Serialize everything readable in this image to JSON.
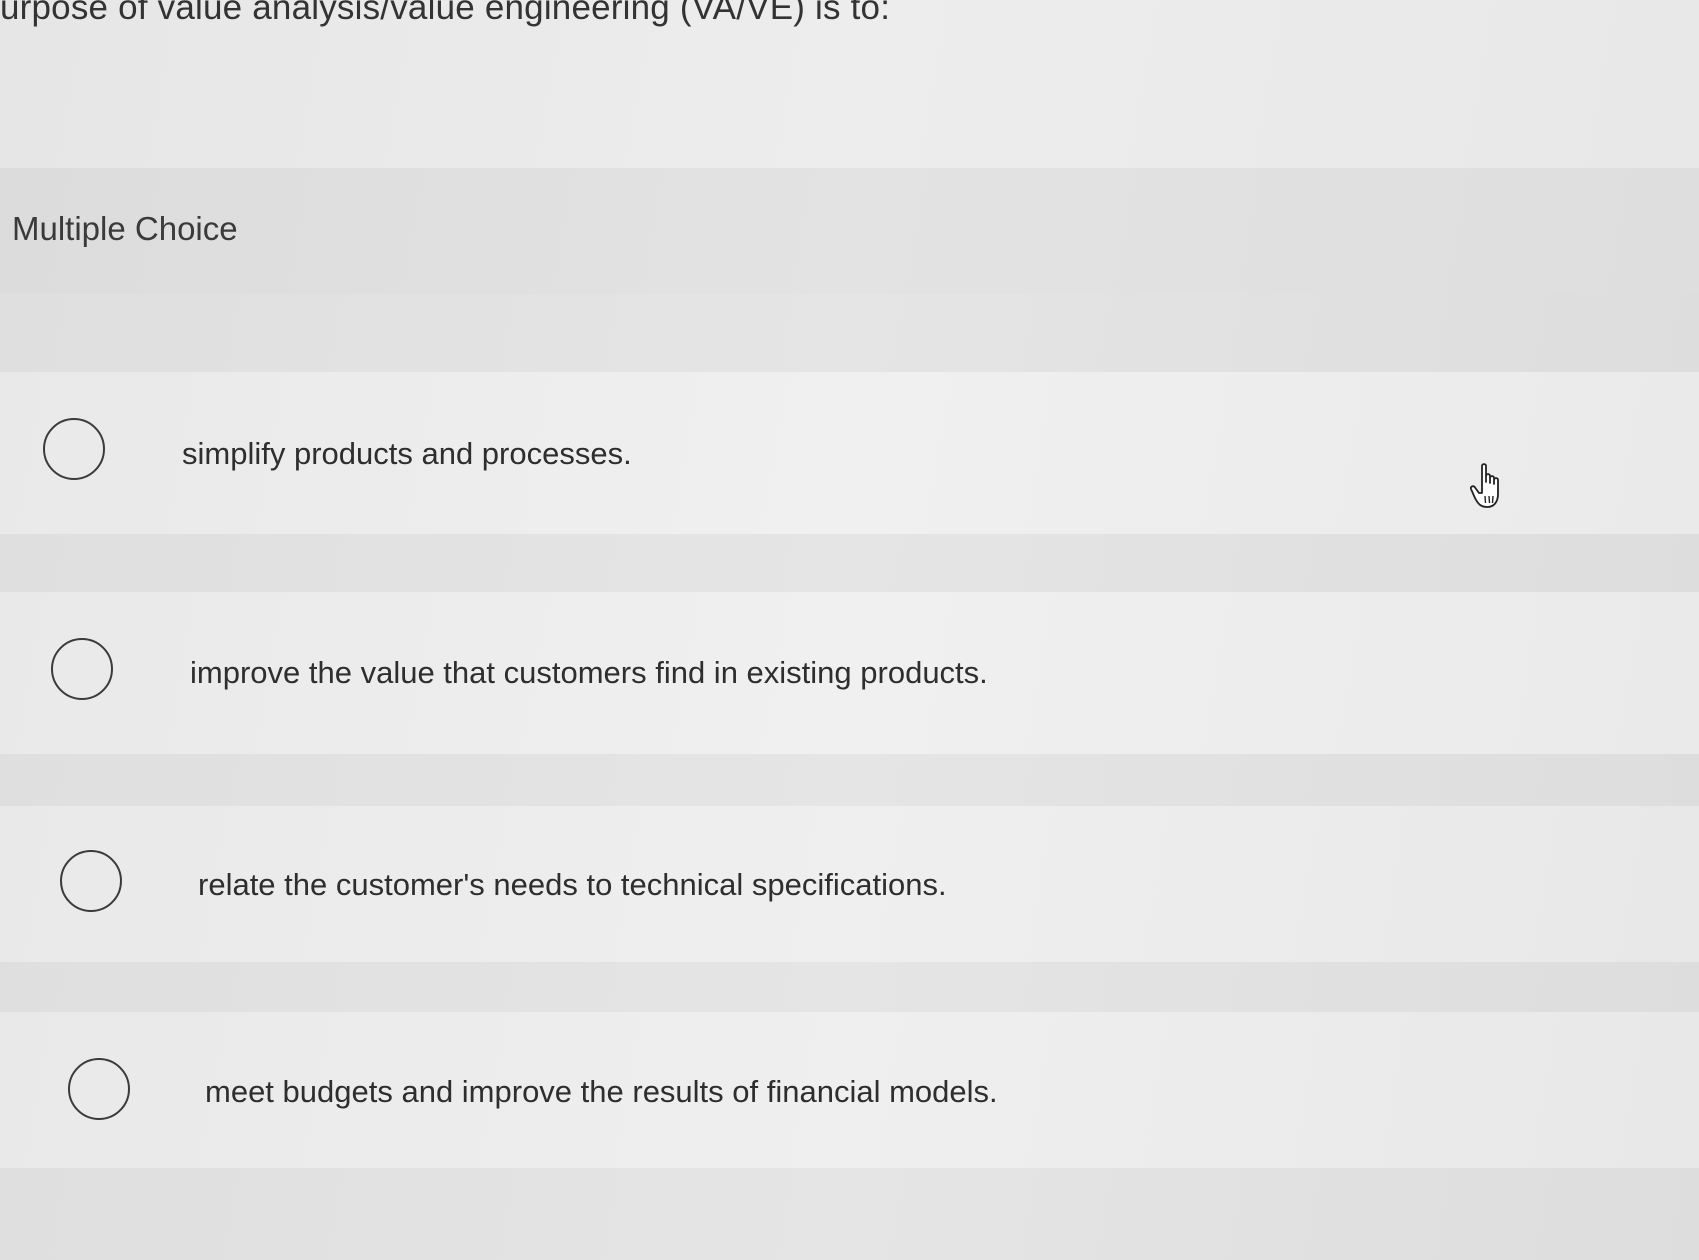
{
  "question": {
    "text": "urpose of value analysis/value engineering (VA/VE) is to:"
  },
  "section": {
    "label": "Multiple Choice"
  },
  "options": [
    {
      "label": "simplify products and processes."
    },
    {
      "label": "improve the value that customers find in existing products."
    },
    {
      "label": "relate the customer's needs to technical specifications."
    },
    {
      "label": "meet budgets and improve the results of financial models."
    }
  ],
  "icons": {
    "cursor": "hand-pointer-icon",
    "radio": "radio-unselected"
  },
  "colors": {
    "background": "#e8e8e8",
    "text": "#2f2f2f",
    "radio_border": "#3b3b3b"
  }
}
